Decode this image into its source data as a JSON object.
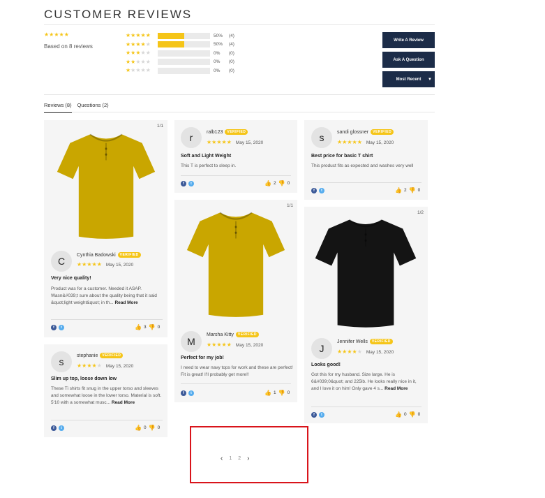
{
  "title": "CUSTOMER REVIEWS",
  "summary": {
    "rating": 5,
    "based_on": "Based on 8 reviews"
  },
  "histogram": [
    {
      "stars": 5,
      "percent": "50%",
      "count": "(4)",
      "fill": 50
    },
    {
      "stars": 4,
      "percent": "50%",
      "count": "(4)",
      "fill": 50
    },
    {
      "stars": 3,
      "percent": "0%",
      "count": "(0)",
      "fill": 0
    },
    {
      "stars": 2,
      "percent": "0%",
      "count": "(0)",
      "fill": 0
    },
    {
      "stars": 1,
      "percent": "0%",
      "count": "(0)",
      "fill": 0
    }
  ],
  "buttons": {
    "write": "Write A Review",
    "ask": "Ask A Question",
    "sort": "Most Recent"
  },
  "tabs": {
    "reviews": "Reviews (8)",
    "questions": "Questions (2)"
  },
  "verified_label": "VERIFIED",
  "reviews": [
    {
      "initial": "C",
      "author": "Cynthia Badowski",
      "date": "May 15, 2020",
      "title": "Very nice quality!",
      "body": "Product was for a customer. Needed it ASAP. Wasn&#039;t sure about the quality being that it said &quot;light weight&quot; in th...",
      "read_more": "Read More",
      "up": "3",
      "down": "0",
      "counter": "1/1"
    },
    {
      "initial": "s",
      "author": "stephanie",
      "date": "May 15, 2020",
      "title": "Slim up top, loose down low",
      "body": "These Ti shirts fit snug in the upper torso and sleeves and somewhat loose in the lower torso. Material is soft. 5'10 with a somewhat musc...",
      "read_more": "Read More",
      "up": "0",
      "down": "0"
    },
    {
      "initial": "r",
      "author": "ralb123",
      "date": "May 15, 2020",
      "title": "Soft and Light Weight",
      "body": "This T is perfect to sleep in.",
      "up": "2",
      "down": "0"
    },
    {
      "initial": "M",
      "author": "Marsha Kitty",
      "date": "May 15, 2020",
      "title": "Perfect for my job!",
      "body": "I need to wear navy tops for work and these are perfect! Fit is great! I'll probably get more!!",
      "up": "1",
      "down": "0",
      "counter": "1/1"
    },
    {
      "initial": "s",
      "author": "sandi glossner",
      "date": "May 15, 2020",
      "title": "Best price for basic T shirt",
      "body": "This product fits as expected and washes very well",
      "up": "2",
      "down": "0"
    },
    {
      "initial": "J",
      "author": "Jennifer Wells",
      "date": "May 15, 2020",
      "title": "Looks good!",
      "body": "Got this for my husband. Size large. He is 6&#039;0&quot; and 225lb. He looks really nice in it, and I love it on him! Only gave 4 s...",
      "read_more": "Read More",
      "up": "0",
      "down": "0",
      "counter": "1/2"
    }
  ],
  "pagination": {
    "prev": "‹",
    "pages": [
      "1",
      "2"
    ],
    "next": "›"
  },
  "colors": {
    "star": "#f5c518",
    "button": "#1c2c48",
    "highlight": "#d9141b",
    "shirt_yellow": "#c9a600",
    "shirt_black": "#141414"
  }
}
